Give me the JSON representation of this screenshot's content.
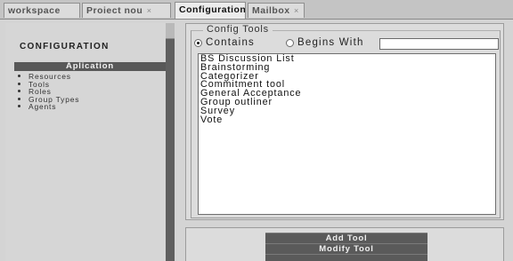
{
  "tabs": [
    {
      "label": "workspace",
      "closable": false,
      "active": false
    },
    {
      "label": "Proiect nou",
      "closable": true,
      "active": false
    },
    {
      "label": "Configuration",
      "closable": true,
      "active": true
    },
    {
      "label": "Mailbox",
      "closable": true,
      "active": false
    }
  ],
  "close_glyph": "×",
  "sidebar": {
    "title": "CONFIGURATION",
    "section": "Aplication",
    "items": [
      "Resources",
      "Tools",
      "Roles",
      "Group Types",
      "Agents"
    ]
  },
  "config_tools": {
    "legend": "Config Tools",
    "match_mode": {
      "options": [
        "Contains",
        "Begins With"
      ],
      "selected": "Contains"
    },
    "filter": {
      "value": "",
      "placeholder": ""
    },
    "tools": [
      "BS Discussion List",
      "Brainstorming",
      "Categorizer",
      "Commitment tool",
      "General Acceptance",
      "Group outliner",
      "Survey",
      "Vote"
    ]
  },
  "actions": {
    "add_label": "Add Tool",
    "modify_label": "Modify Tool"
  },
  "colors": {
    "dark_bar": "#585858",
    "panel": "#dcdcdc",
    "background": "#d4d4d4"
  }
}
